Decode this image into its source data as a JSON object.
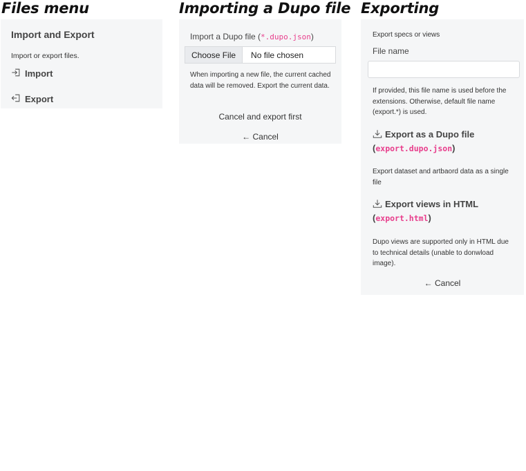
{
  "sections": {
    "files_menu": "Files menu",
    "importing": "Importing a Dupo file",
    "exporting": "Exporting"
  },
  "files_menu": {
    "header": "Import and Export",
    "description": "Import or export files.",
    "items": [
      {
        "label": "Import",
        "icon": "import-icon"
      },
      {
        "label": "Export",
        "icon": "export-icon"
      }
    ]
  },
  "importing": {
    "label_prefix": "Import a Dupo file (",
    "label_code": "*.dupo.json",
    "label_suffix": ")",
    "choose_file": "Choose File",
    "no_file": "No file chosen",
    "note": "When importing a new file, the current cached data will be removed. Export the current data.",
    "cancel_export_first": "Cancel and export first",
    "cancel": "← Cancel"
  },
  "exporting": {
    "intro": "Export specs or views",
    "file_name_label": "File name",
    "file_name_value": "",
    "file_name_help": "If provided, this file name is used before the extensions. Otherwise, default file name (export.*) is used.",
    "dupo_link": "Export as a Dupo file",
    "dupo_code": "export.dupo.json",
    "dupo_desc": "Export dataset and artbaord data as a single file",
    "html_link": "Export views in HTML",
    "html_code": "export.html",
    "html_desc": "Dupo views are supported only in HTML due to technical details (unable to donwload image).",
    "cancel": "← Cancel"
  },
  "colors": {
    "panel_bg": "#f5f6f7",
    "code": "#e83e8c"
  }
}
